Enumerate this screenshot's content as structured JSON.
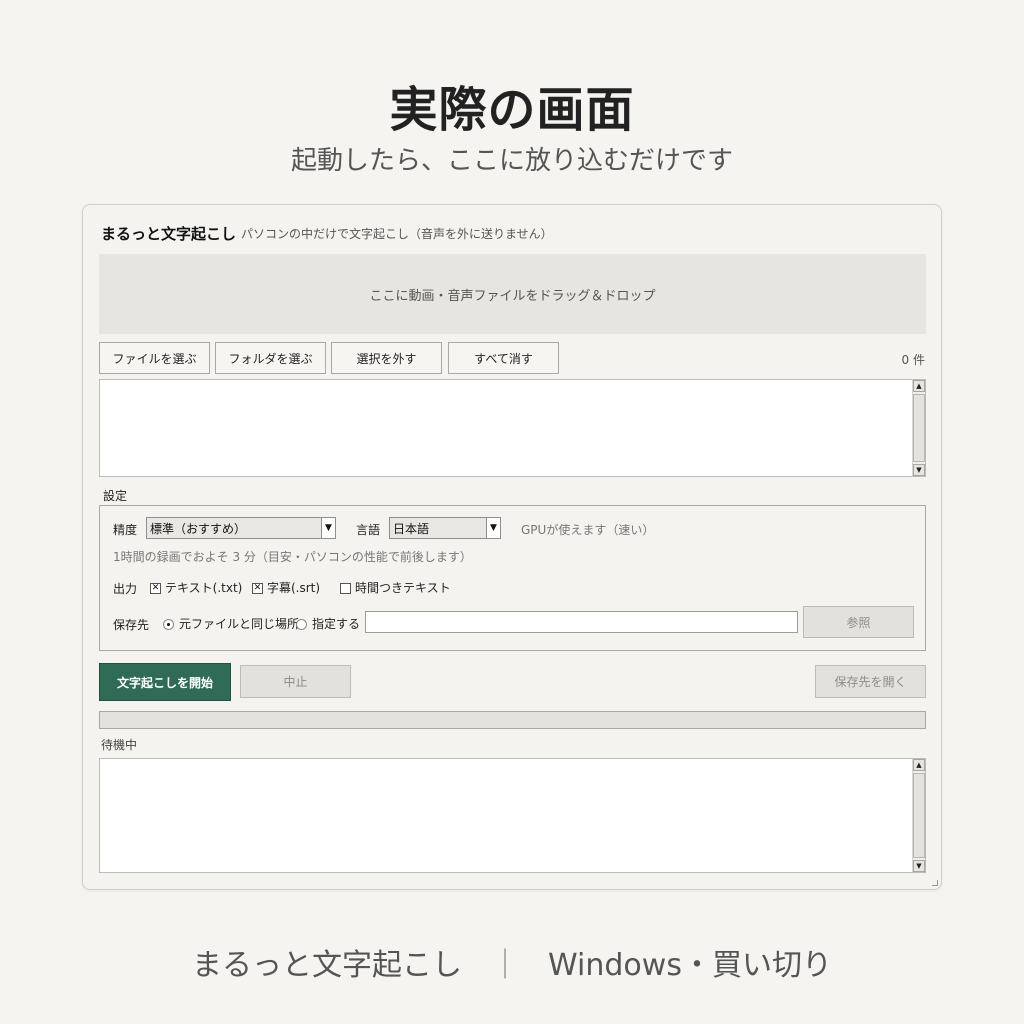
{
  "hero": {
    "title": "実際の画面",
    "subtitle": "起動したら、ここに放り込むだけです"
  },
  "footer": {
    "product": "まるっと文字起こし",
    "separator": "｜",
    "platform": "Windows・買い切り"
  },
  "app": {
    "title": "まるっと文字起こし",
    "description": "パソコンの中だけで文字起こし（音声を外に送りません）",
    "dropzone_text": "ここに動画・音声ファイルをドラッグ＆ドロップ",
    "file_buttons": {
      "choose_files": "ファイルを選ぶ",
      "choose_folder": "フォルダを選ぶ",
      "deselect": "選択を外す",
      "clear_all": "すべて消す"
    },
    "file_count": "0 件",
    "settings": {
      "group_label": "設定",
      "accuracy_label": "精度",
      "accuracy_value": "標準（おすすめ）",
      "language_label": "言語",
      "language_value": "日本語",
      "gpu_status": "GPUが使えます（速い）",
      "time_estimate": "1時間の録画でおよそ 3 分（目安・パソコンの性能で前後します）",
      "output_label": "出力",
      "output_options": [
        {
          "label": "テキスト(.txt)",
          "checked": true
        },
        {
          "label": "字幕(.srt)",
          "checked": true
        },
        {
          "label": "時間つきテキスト",
          "checked": false
        }
      ],
      "save_label": "保存先",
      "save_options": [
        {
          "label": "元ファイルと同じ場所",
          "selected": true
        },
        {
          "label": "指定する",
          "selected": false
        }
      ],
      "save_path_value": "",
      "browse_button": "参照"
    },
    "actions": {
      "start": "文字起こしを開始",
      "stop": "中止",
      "open_folder": "保存先を開く"
    },
    "progress": 0,
    "status_text": "待機中",
    "colors": {
      "primary_button": "#2f6b57",
      "background": "#f5f4f0"
    }
  }
}
